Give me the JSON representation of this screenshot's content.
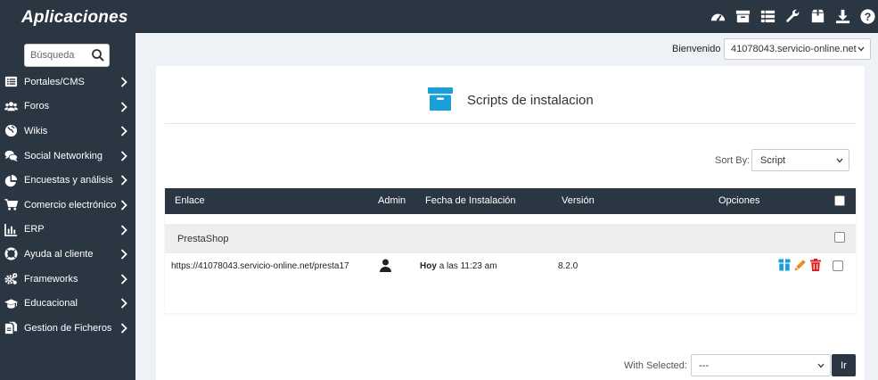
{
  "app": {
    "title": "Aplicaciones"
  },
  "top_icons": [
    "dashboard-icon",
    "archive-icon",
    "list-icon",
    "wrench-icon",
    "box-icon",
    "download-icon",
    "help-icon"
  ],
  "search": {
    "placeholder": "Búsqueda"
  },
  "sidebar": {
    "items": [
      {
        "label": "Portales/CMS",
        "icon": "list-icon"
      },
      {
        "label": "Foros",
        "icon": "users-icon"
      },
      {
        "label": "Wikis",
        "icon": "globe-icon"
      },
      {
        "label": "Social Networking",
        "icon": "comments-icon"
      },
      {
        "label": "Encuestas y análisis",
        "icon": "pie-chart-icon"
      },
      {
        "label": "Comercio electrónico",
        "icon": "cart-icon"
      },
      {
        "label": "ERP",
        "icon": "bar-chart-icon"
      },
      {
        "label": "Ayuda al cliente",
        "icon": "lifebuoy-icon"
      },
      {
        "label": "Frameworks",
        "icon": "gears-icon"
      },
      {
        "label": "Educacional",
        "icon": "graduation-cap-icon"
      },
      {
        "label": "Gestion de Ficheros",
        "icon": "files-icon"
      }
    ]
  },
  "header": {
    "welcome": "Bienvenido",
    "site": "41078043.servicio-online.net"
  },
  "panel": {
    "title": "Scripts de instalacion"
  },
  "sort": {
    "label": "Sort By:",
    "value": "Script"
  },
  "table": {
    "columns": [
      "Enlace",
      "Admin",
      "Fecha de Instalación",
      "Versión",
      "Opciones"
    ],
    "group": "PrestaShop",
    "rows": [
      {
        "link": "https://41078043.servicio-online.net/presta17",
        "date_bold": "Hoy",
        "date_rest": "a las 11:23 am",
        "version": "8.2.0"
      }
    ]
  },
  "bulk": {
    "label": "With Selected:",
    "value": "---",
    "go": "Ir"
  },
  "colors": {
    "dark": "#2b3643",
    "accent": "#1a9fd9",
    "edit": "#f08a24",
    "delete": "#e02020"
  }
}
